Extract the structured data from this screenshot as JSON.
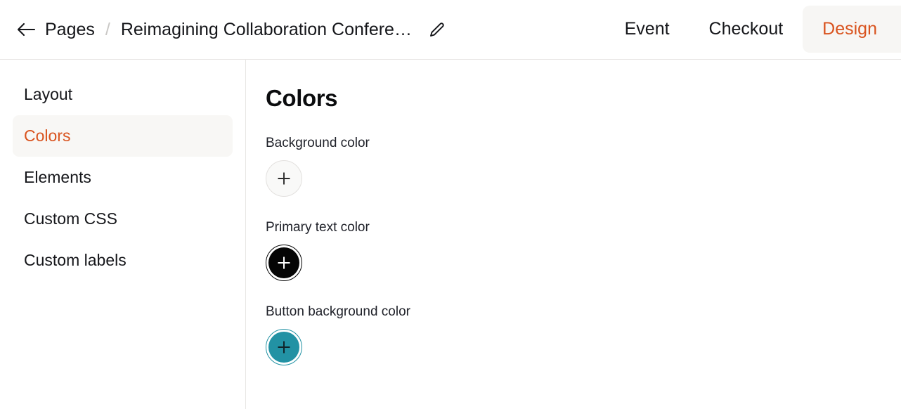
{
  "header": {
    "back_icon": "arrow-left-icon",
    "breadcrumb_parent": "Pages",
    "breadcrumb_separator": "/",
    "page_name": "Reimagining Collaboration Confere…",
    "edit_icon": "pencil-icon",
    "tabs": [
      {
        "label": "Event",
        "active": false
      },
      {
        "label": "Checkout",
        "active": false
      },
      {
        "label": "Design",
        "active": true
      }
    ]
  },
  "sidebar": {
    "items": [
      {
        "label": "Layout",
        "active": false
      },
      {
        "label": "Colors",
        "active": true
      },
      {
        "label": "Elements",
        "active": false
      },
      {
        "label": "Custom CSS",
        "active": false
      },
      {
        "label": "Custom labels",
        "active": false
      }
    ]
  },
  "main": {
    "title": "Colors",
    "fields": [
      {
        "label": "Background color",
        "swatch_icon": "plus-icon",
        "swatch_style": "plain",
        "fill": "#F9F9F8",
        "border": "#E2E0DE",
        "plus_color": "#2B2B2B"
      },
      {
        "label": "Primary text color",
        "swatch_icon": "plus-icon",
        "swatch_style": "ringed",
        "fill": "#050505",
        "border": "#050505",
        "plus_color": "#FFFFFF"
      },
      {
        "label": "Button background color",
        "swatch_icon": "plus-icon",
        "swatch_style": "ringed",
        "fill": "#2292A4",
        "border": "#2292A4",
        "plus_color": "#10252B"
      }
    ]
  },
  "colors": {
    "accent_orange": "#D9531E",
    "active_tab_bg": "#F7F6F4",
    "active_nav_bg": "#F8F7F5",
    "divider": "#E8E6E4",
    "text_primary": "#15161A"
  }
}
